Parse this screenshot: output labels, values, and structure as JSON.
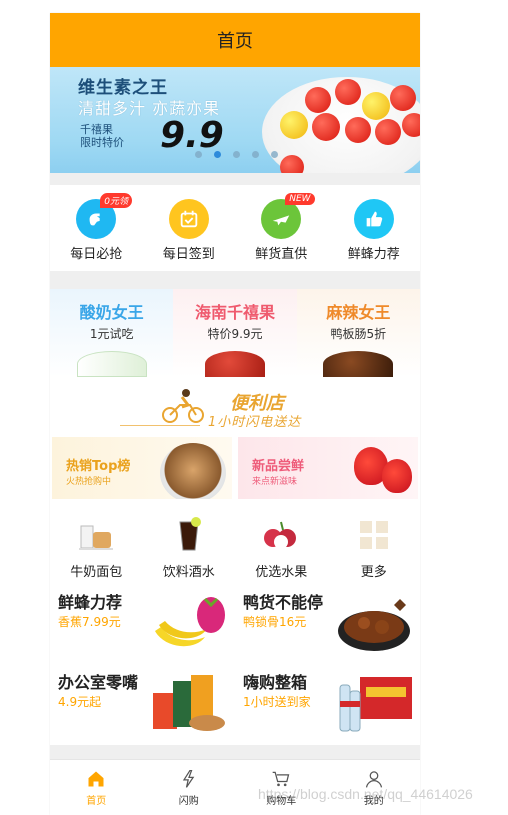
{
  "header": {
    "title": "首页"
  },
  "banner": {
    "title": "维生素之王",
    "subtitle": "清甜多汁 亦蔬亦果",
    "product": "千禧果",
    "limited": "限时特价",
    "price": "9.9"
  },
  "quick": [
    {
      "label": "每日必抢",
      "badge": "0元领",
      "icon": "hand-icon",
      "color": "#1fb8f2"
    },
    {
      "label": "每日签到",
      "badge": "",
      "icon": "calendar-icon",
      "color": "#ffc51f"
    },
    {
      "label": "鲜货直供",
      "badge": "NEW",
      "icon": "plane-icon",
      "color": "#6cc53a"
    },
    {
      "label": "鲜蜂力荐",
      "badge": "",
      "icon": "thumbs-up-icon",
      "color": "#1fc7f5"
    }
  ],
  "promos": [
    {
      "title": "酸奶女王",
      "sub": "1元试吃",
      "color": "#3aa6e8"
    },
    {
      "title": "海南千禧果",
      "sub": "特价9.9元",
      "color": "#ef5a6e"
    },
    {
      "title": "麻辣女王",
      "sub": "鸭板肠5折",
      "color": "#ef8a2a"
    }
  ],
  "store": {
    "name": "便利店",
    "tagline": "1小时闪电送达"
  },
  "cards": [
    {
      "title": "热销Top榜",
      "sub": "火热抢购中"
    },
    {
      "title": "新品尝鲜",
      "sub": "来点新滋味"
    }
  ],
  "categories": [
    {
      "label": "牛奶面包"
    },
    {
      "label": "饮料酒水"
    },
    {
      "label": "优选水果"
    },
    {
      "label": "更多"
    }
  ],
  "products": [
    {
      "name": "鲜蜂力荐",
      "price": "香蕉7.99元"
    },
    {
      "name": "鸭货不能停",
      "price": "鸭锁骨16元"
    },
    {
      "name": "办公室零嘴",
      "price": "4.9元起"
    },
    {
      "name": "嗨购整箱",
      "price": "1小时送到家"
    }
  ],
  "tabs": [
    {
      "label": "首页",
      "active": true
    },
    {
      "label": "闪购",
      "active": false
    },
    {
      "label": "购物车",
      "active": false
    },
    {
      "label": "我的",
      "active": false
    }
  ],
  "watermark": "https://blog.csdn.net/qq_44614026",
  "colors": {
    "accent": "#ffa500"
  }
}
